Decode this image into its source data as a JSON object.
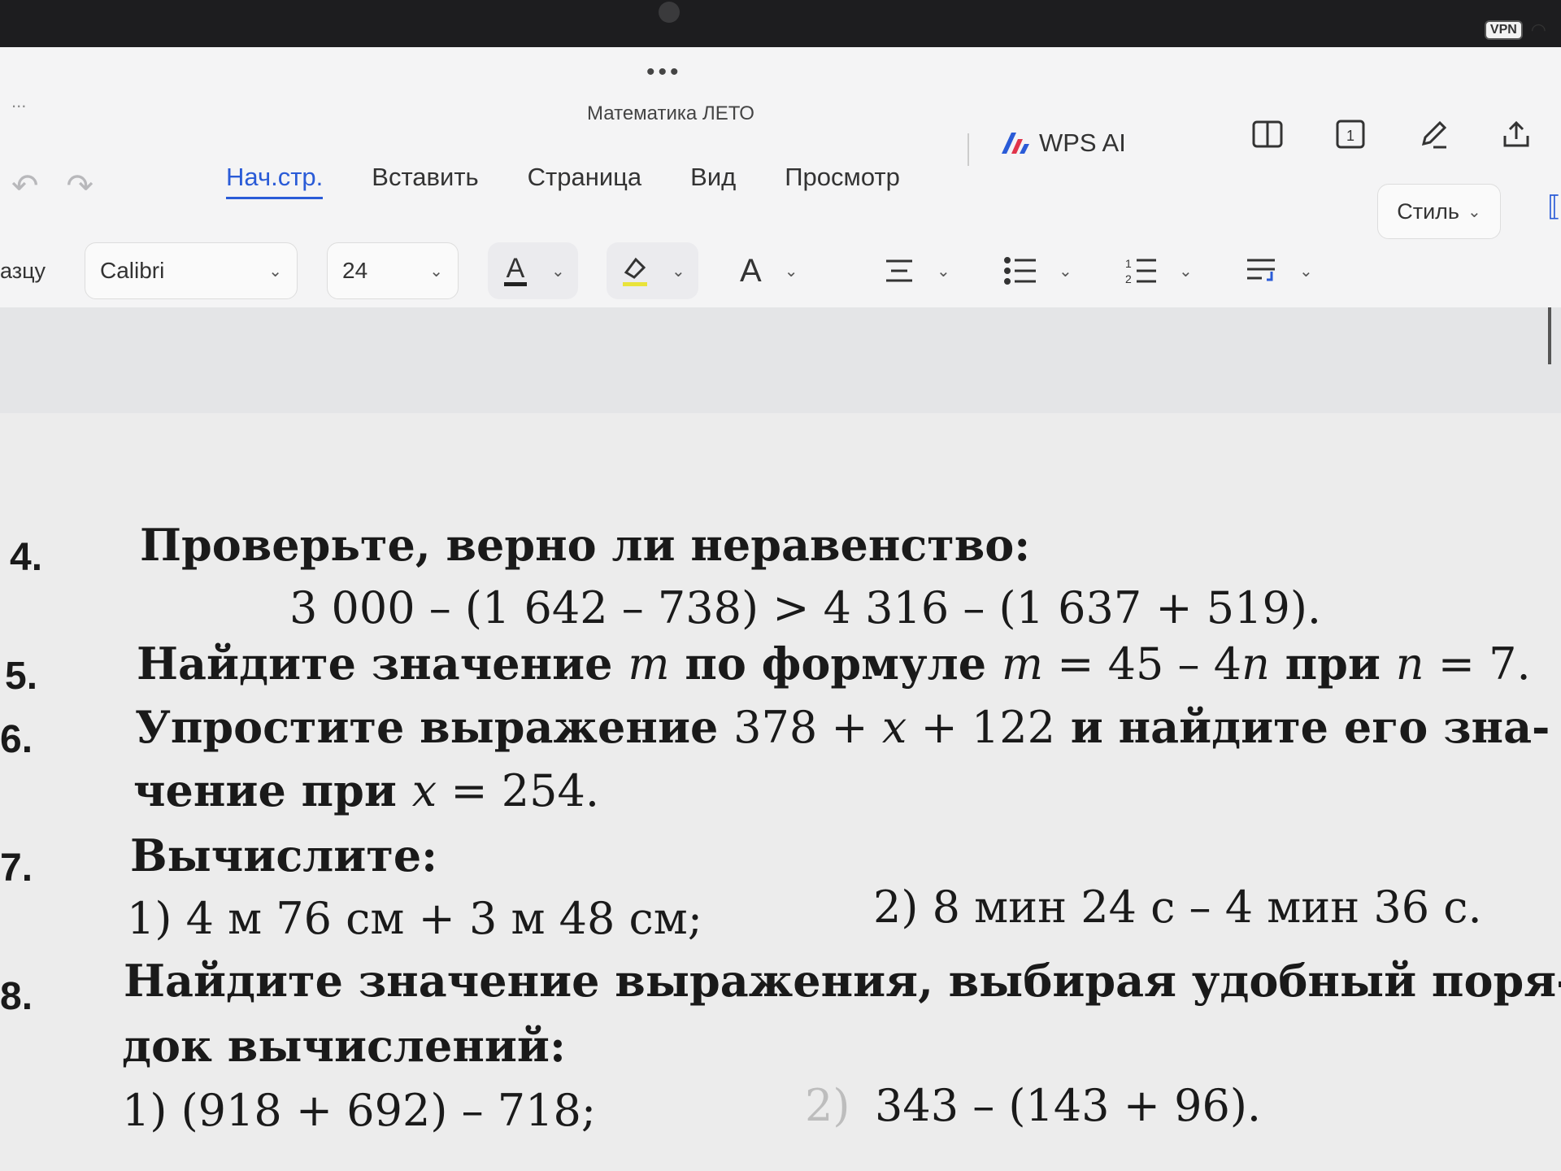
{
  "app": {
    "title": "Математика ЛЕТО",
    "more_dots": "•••",
    "left_stub": "...",
    "vpn_badge": "VPN",
    "tabs": [
      {
        "label": "Нач.стр.",
        "active": true
      },
      {
        "label": "Вставить"
      },
      {
        "label": "Страница"
      },
      {
        "label": "Вид"
      },
      {
        "label": "Просмотр"
      }
    ],
    "wps_ai": "WPS AI",
    "format": {
      "style_stub": "азцу",
      "font_name": "Calibri",
      "font_size": "24",
      "style_label": "Стиль"
    },
    "accent": "#2a5bd7",
    "icons": [
      "undo-icon",
      "redo-icon",
      "book-icon",
      "page-icon",
      "pen-icon",
      "share-icon",
      "font-color-icon",
      "highlight-icon",
      "font-case-icon",
      "align-icon",
      "bullet-list-icon",
      "numbered-list-icon",
      "line-spacing-icon"
    ]
  },
  "document": {
    "items": [
      {
        "number": "4.",
        "text": "Проверьте, верно ли неравенство:",
        "expr": "3 000 – (1 642 – 738) > 4 316 – (1 637 + 519)."
      },
      {
        "number": "5.",
        "parts": [
          "Найдите значение ",
          "m",
          " по формуле ",
          "m",
          " = 45 – 4",
          "n",
          " при ",
          "n",
          " = 7."
        ]
      },
      {
        "number": "6.",
        "parts": [
          "Упростите выражение ",
          "378 + ",
          "x",
          " + 122",
          " и найдите его зна-"
        ],
        "cont_parts": [
          "чение при ",
          "x",
          " = 254."
        ]
      },
      {
        "number": "7.",
        "text": "Вычислите:",
        "sub1": "1) 4 м 76 см + 3 м 48 см;",
        "sub2": "2) 8 мин 24 с – 4 мин 36 с."
      },
      {
        "number": "8.",
        "text": "Найдите значение выражения, выбирая удобный поря-",
        "cont": "док вычислений:",
        "sub1": "1) (918 + 692) – 718;",
        "sub2_label": "2)",
        "sub2": "343 – (143 + 96)."
      }
    ]
  }
}
